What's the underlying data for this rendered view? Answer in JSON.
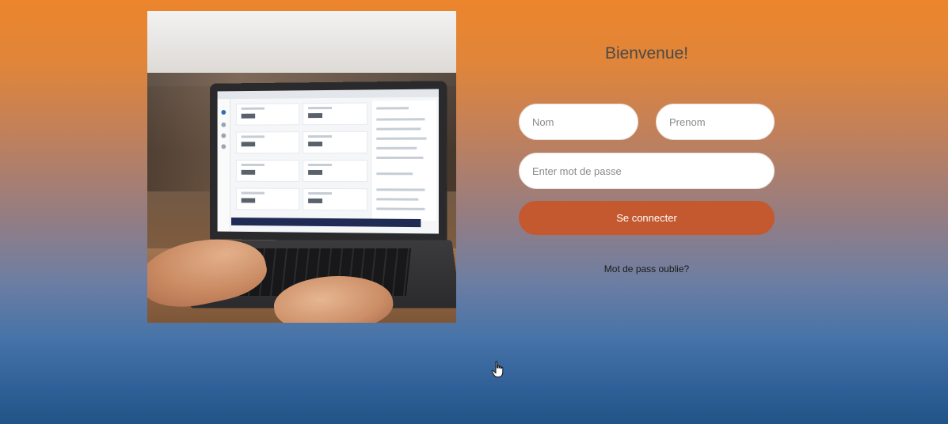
{
  "photo": {
    "alt": "laptop-with-hands-typing"
  },
  "form": {
    "title": "Bienvenue!",
    "nom_placeholder": "Nom",
    "prenom_placeholder": "Prenom",
    "password_placeholder": "Enter mot de passe",
    "submit_label": "Se connecter",
    "forgot_label": "Mot de pass oublie?"
  },
  "cursor": {
    "icon": "hand-pointer-icon"
  },
  "colors": {
    "gradient_top": "#ec852c",
    "gradient_bottom": "#225487",
    "button": "#c4582f"
  }
}
